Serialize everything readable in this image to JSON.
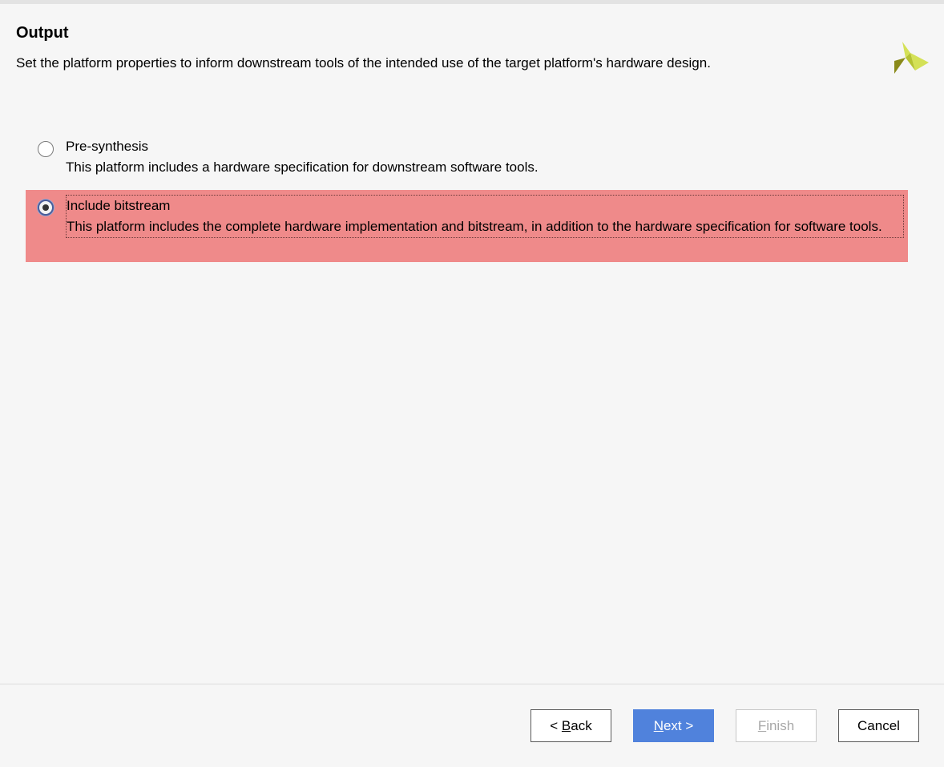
{
  "header": {
    "title": "Output",
    "subtitle": "Set the platform properties to inform downstream tools of the intended use of the target platform's hardware design.",
    "logo_icon": "xilinx-logo-icon"
  },
  "options": [
    {
      "label": "Pre-synthesis",
      "description": "This platform includes a hardware specification for downstream software tools.",
      "selected": false
    },
    {
      "label": "Include bitstream",
      "description": "This platform includes the complete hardware implementation and bitstream, in addition to the hardware specification for software tools.",
      "selected": true
    }
  ],
  "footer": {
    "back": {
      "prefix": "< ",
      "mnemonic": "B",
      "rest": "ack"
    },
    "next": {
      "mnemonic": "N",
      "rest": "ext >"
    },
    "finish": {
      "mnemonic": "F",
      "rest": "inish",
      "enabled": false
    },
    "cancel": {
      "label": "Cancel"
    }
  },
  "colors": {
    "selection_highlight": "#ef8a8a",
    "primary_button": "#5082dc",
    "logo_light": "#d4e157",
    "logo_dark": "#8a8a1a"
  }
}
